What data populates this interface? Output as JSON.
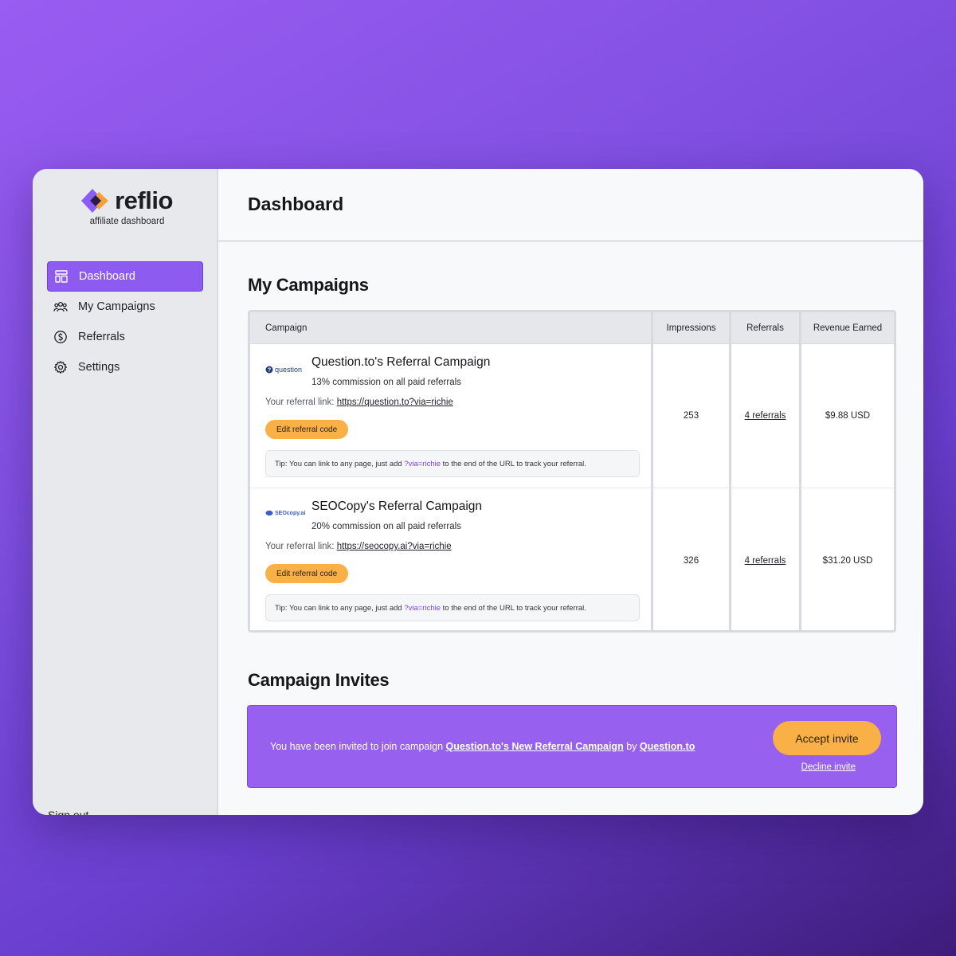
{
  "brand": {
    "name": "reflio",
    "subtitle": "affiliate dashboard"
  },
  "sidebar": {
    "items": [
      {
        "label": "Dashboard",
        "icon": "dashboard-icon",
        "active": true
      },
      {
        "label": "My Campaigns",
        "icon": "users-icon"
      },
      {
        "label": "Referrals",
        "icon": "dollar-icon"
      },
      {
        "label": "Settings",
        "icon": "gear-icon"
      }
    ],
    "signout": "Sign out"
  },
  "header": {
    "title": "Dashboard"
  },
  "campaigns": {
    "title": "My Campaigns",
    "columns": [
      "Campaign",
      "Impressions",
      "Referrals",
      "Revenue Earned"
    ],
    "rows": [
      {
        "logo": "question",
        "name": "Question.to's Referral Campaign",
        "commission": "13% commission on all paid referrals",
        "link_label": "Your referral link:",
        "link": "https://question.to?via=richie",
        "edit_label": "Edit referral code",
        "tip_prefix": "Tip: You can link to any page, just add",
        "tip_param": "?via=richie",
        "tip_suffix": "to the end of the URL to track your referral.",
        "impressions": "253",
        "referrals": "4 referrals",
        "revenue": "$9.88 USD"
      },
      {
        "logo": "SEOcopy.ai",
        "name": "SEOCopy's Referral Campaign",
        "commission": "20% commission on all paid referrals",
        "link_label": "Your referral link:",
        "link": "https://seocopy.ai?via=richie",
        "edit_label": "Edit referral code",
        "tip_prefix": "Tip: You can link to any page, just add",
        "tip_param": "?via=richie",
        "tip_suffix": "to the end of the URL to track your referral.",
        "impressions": "326",
        "referrals": "4 referrals",
        "revenue": "$31.20 USD"
      }
    ]
  },
  "invites": {
    "title": "Campaign Invites",
    "text_prefix": "You have been invited to join campaign",
    "campaign": "Question.to's New Referral Campaign",
    "by": "by",
    "company": "Question.to",
    "accept": "Accept invite",
    "decline": "Decline invite"
  },
  "colors": {
    "accent": "#8e5bf0",
    "button": "#f9b047"
  }
}
